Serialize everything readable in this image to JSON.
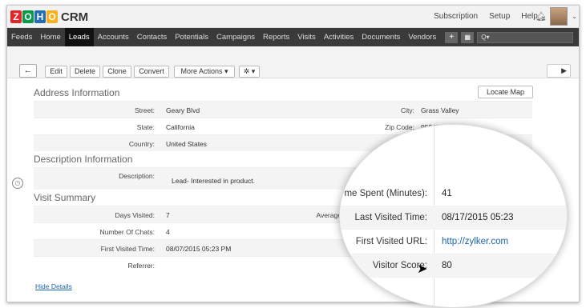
{
  "app": {
    "logo_letters": [
      "Z",
      "O",
      "H",
      "O"
    ],
    "logo_colors": [
      "#e42527",
      "#089949",
      "#226db4",
      "#f9b21d"
    ],
    "name": "CRM"
  },
  "top_links": {
    "subscription": "Subscription",
    "setup": "Setup",
    "help": "Help ⌄"
  },
  "nav": {
    "tabs": [
      "Feeds",
      "Home",
      "Leads",
      "Accounts",
      "Contacts",
      "Potentials",
      "Campaigns",
      "Reports",
      "Visits",
      "Activities",
      "Documents",
      "Vendors"
    ],
    "active_index": 2,
    "plus": "+",
    "search": "Q▾"
  },
  "toolbar": {
    "back": "←",
    "edit": "Edit",
    "delete": "Delete",
    "clone": "Clone",
    "convert": "Convert",
    "more": "More Actions ▾",
    "gear": "✲ ▾",
    "next": "▶"
  },
  "address": {
    "title": "Address Information",
    "locate": "Locate Map",
    "street_label": "Street:",
    "street": "Geary Blvd",
    "city_label": "City:",
    "city": "Grass Valley",
    "state_label": "State:",
    "state": "California",
    "zip_label": "Zip Code:",
    "zip": "95945",
    "country_label": "Country:",
    "country": "United States"
  },
  "description": {
    "title": "Description Information",
    "label": "Description:",
    "value": "Lead- Interested in product."
  },
  "visit": {
    "title": "Visit Summary",
    "days_label": "Days Visited:",
    "days": "7",
    "avg_label": "Average Tim",
    "chats_label": "Number Of Chats:",
    "chats": "4",
    "first_label": "First Visited Time:",
    "first": "08/07/2015 05:23 PM",
    "referrer_label": "Referrer:"
  },
  "magnifier": {
    "time_spent_label": "me Spent (Minutes):",
    "time_spent": "41",
    "last_visited_label": "Last Visited Time:",
    "last_visited": "08/17/2015 05:23",
    "first_url_label": "First Visited URL:",
    "first_url": "http://zylker.com",
    "score_label": "Visitor Score:",
    "score": "80"
  },
  "footer": {
    "hide": "Hide Details"
  }
}
